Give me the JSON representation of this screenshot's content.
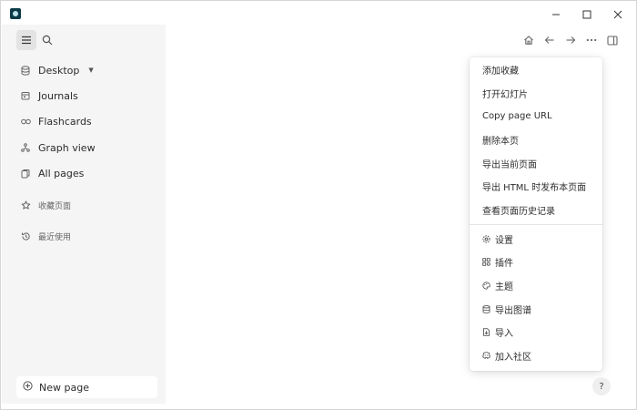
{
  "sidebar": {
    "items": [
      {
        "label": "Desktop",
        "icon": "database-icon"
      },
      {
        "label": "Journals",
        "icon": "calendar-icon"
      },
      {
        "label": "Flashcards",
        "icon": "infinity-icon"
      },
      {
        "label": "Graph view",
        "icon": "graph-icon"
      },
      {
        "label": "All pages",
        "icon": "pages-icon"
      }
    ],
    "favorites_label": "收藏页面",
    "recent_label": "最近使用",
    "new_page_label": "New page"
  },
  "menu": {
    "items": [
      "添加收藏",
      "打开幻灯片",
      "Copy page URL",
      "删除本页",
      "导出当前页面",
      "导出 HTML 时发布本页面",
      "查看页面历史记录"
    ],
    "settings_items": [
      {
        "label": "设置",
        "icon": "gear-icon"
      },
      {
        "label": "插件",
        "icon": "plugins-icon"
      },
      {
        "label": "主题",
        "icon": "palette-icon"
      },
      {
        "label": "导出图谱",
        "icon": "export-graph-icon"
      },
      {
        "label": "导入",
        "icon": "import-icon"
      },
      {
        "label": "加入社区",
        "icon": "discord-icon"
      }
    ]
  },
  "help_label": "?"
}
